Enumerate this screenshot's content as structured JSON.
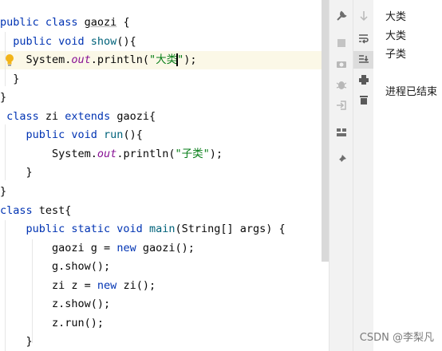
{
  "editor": {
    "code": {
      "l1": {
        "a": "public class ",
        "b": "gaozi",
        "c": " {"
      },
      "l2": {
        "a": "  public void ",
        "b": "show",
        "c": "(){"
      },
      "l3": {
        "a": "    System.",
        "b": "out",
        "c": ".println(",
        "d": "\"大类",
        "e": "\"",
        "f": ");"
      },
      "l4": "  }",
      "l5": "}",
      "l6": {
        "a": " class ",
        "b": "zi ",
        "c": "extends ",
        "d": "gaozi{"
      },
      "l7": {
        "a": "    public void ",
        "b": "run",
        "c": "(){"
      },
      "l8": {
        "a": "        System.",
        "b": "out",
        "c": ".println(",
        "d": "\"子类\"",
        "e": ");"
      },
      "l9": "    }",
      "l10": "}",
      "l11": {
        "a": "class ",
        "b": "test{"
      },
      "l12": {
        "a": "    public static void ",
        "b": "main",
        "c": "(String[] args) {"
      },
      "l13": {
        "a": "        gaozi g = ",
        "b": "new ",
        "c": "gaozi();"
      },
      "l14": "        g.show();",
      "l15": {
        "a": "        zi z = ",
        "b": "new ",
        "c": "zi();"
      },
      "l16": "        z.show();",
      "l17": "        z.run();",
      "l18": "    }"
    },
    "intention_icon": "lightbulb-icon"
  },
  "toolbar_left": {
    "icons": [
      "wrench-icon",
      "stop-icon",
      "camera-icon",
      "bug-icon",
      "login-icon",
      "layout-icon",
      "pin-icon"
    ]
  },
  "toolbar_right": {
    "icons": [
      "arrow-down-icon",
      "soft-wrap-icon",
      "scroll-to-end-icon",
      "print-icon",
      "trash-icon"
    ]
  },
  "console": {
    "lines": [
      "大类",
      "大类",
      "子类",
      "进程已结束"
    ]
  },
  "watermark": "CSDN @李梨凡",
  "colors": {
    "keyword": "#0033b3",
    "method": "#00627a",
    "string": "#067d17",
    "static_field": "#871094",
    "current_line": "#fbf8e7"
  }
}
